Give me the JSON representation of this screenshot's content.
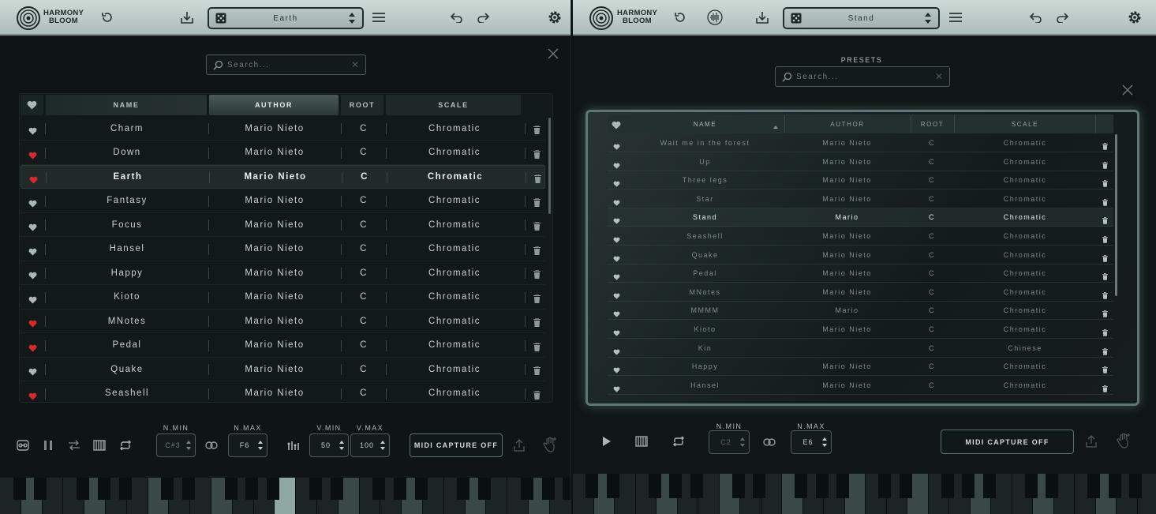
{
  "left": {
    "brand_line1": "HARMONY",
    "brand_line2": "BLOOM",
    "preset_name": "Earth",
    "search_placeholder": "Search...",
    "columns": {
      "name": "NAME",
      "author": "AUTHOR",
      "root": "ROOT",
      "scale": "SCALE"
    },
    "rows": [
      {
        "name": "Charm",
        "author": "Mario Nieto",
        "root": "C",
        "scale": "Chromatic",
        "fav": false
      },
      {
        "name": "Down",
        "author": "Mario Nieto",
        "root": "C",
        "scale": "Chromatic",
        "fav": true
      },
      {
        "name": "Earth",
        "author": "Mario Nieto",
        "root": "C",
        "scale": "Chromatic",
        "fav": true,
        "selected": true
      },
      {
        "name": "Fantasy",
        "author": "Mario Nieto",
        "root": "C",
        "scale": "Chromatic",
        "fav": false
      },
      {
        "name": "Focus",
        "author": "Mario Nieto",
        "root": "C",
        "scale": "Chromatic",
        "fav": false
      },
      {
        "name": "Hansel",
        "author": "Mario Nieto",
        "root": "C",
        "scale": "Chromatic",
        "fav": false
      },
      {
        "name": "Happy",
        "author": "Mario Nieto",
        "root": "C",
        "scale": "Chromatic",
        "fav": false
      },
      {
        "name": "Kioto",
        "author": "Mario Nieto",
        "root": "C",
        "scale": "Chromatic",
        "fav": false
      },
      {
        "name": "MNotes",
        "author": "Mario Nieto",
        "root": "C",
        "scale": "Chromatic",
        "fav": true
      },
      {
        "name": "Pedal",
        "author": "Mario Nieto",
        "root": "C",
        "scale": "Chromatic",
        "fav": true
      },
      {
        "name": "Quake",
        "author": "Mario Nieto",
        "root": "C",
        "scale": "Chromatic",
        "fav": false
      },
      {
        "name": "Seashell",
        "author": "Mario Nieto",
        "root": "C",
        "scale": "Chromatic",
        "fav": true
      }
    ],
    "controls": {
      "nmin_label": "N.MIN",
      "nmin_value": "C#3",
      "nmax_label": "N.MAX",
      "nmax_value": "F6",
      "vmin_label": "V.MIN",
      "vmin_value": "50",
      "vmax_label": "V.MAX",
      "vmax_value": "100",
      "midi_capture": "MIDI CAPTURE OFF"
    }
  },
  "right": {
    "brand_line1": "HARMONY",
    "brand_line2": "BLOOM",
    "preset_name": "Stand",
    "presets_title": "PRESETS",
    "search_placeholder": "Search...",
    "columns": {
      "name": "NAME",
      "author": "AUTHOR",
      "root": "ROOT",
      "scale": "SCALE"
    },
    "rows": [
      {
        "name": "Wait me in the forest",
        "author": "Mario Nieto",
        "root": "C",
        "scale": "Chromatic"
      },
      {
        "name": "Up",
        "author": "Mario Nieto",
        "root": "C",
        "scale": "Chromatic"
      },
      {
        "name": "Three legs",
        "author": "Mario Nieto",
        "root": "C",
        "scale": "Chromatic"
      },
      {
        "name": "Star",
        "author": "Mario Nieto",
        "root": "C",
        "scale": "Chromatic"
      },
      {
        "name": "Stand",
        "author": "Mario",
        "root": "C",
        "scale": "Chromatic",
        "selected": true
      },
      {
        "name": "Seashell",
        "author": "Mario Nieto",
        "root": "C",
        "scale": "Chromatic"
      },
      {
        "name": "Quake",
        "author": "Mario Nieto",
        "root": "C",
        "scale": "Chromatic"
      },
      {
        "name": "Pedal",
        "author": "Mario Nieto",
        "root": "C",
        "scale": "Chromatic"
      },
      {
        "name": "MNotes",
        "author": "Mario Nieto",
        "root": "C",
        "scale": "Chromatic"
      },
      {
        "name": "MMMM",
        "author": "Mario",
        "root": "C",
        "scale": "Chromatic"
      },
      {
        "name": "Kioto",
        "author": "Mario Nieto",
        "root": "C",
        "scale": "Chromatic"
      },
      {
        "name": "Kin",
        "author": "",
        "root": "C",
        "scale": "Chinese"
      },
      {
        "name": "Happy",
        "author": "Mario Nieto",
        "root": "C",
        "scale": "Chromatic"
      },
      {
        "name": "Hansel",
        "author": "Mario Nieto",
        "root": "C",
        "scale": "Chromatic"
      }
    ],
    "controls": {
      "nmin_label": "N.MIN",
      "nmin_value": "C2",
      "nmax_label": "N.MAX",
      "nmax_value": "E6",
      "midi_capture": "MIDI CAPTURE OFF"
    }
  },
  "colors": {
    "fav_red": "#d8282d",
    "heart_grey": "#a9b8b5",
    "topbar": "#bccac7"
  }
}
